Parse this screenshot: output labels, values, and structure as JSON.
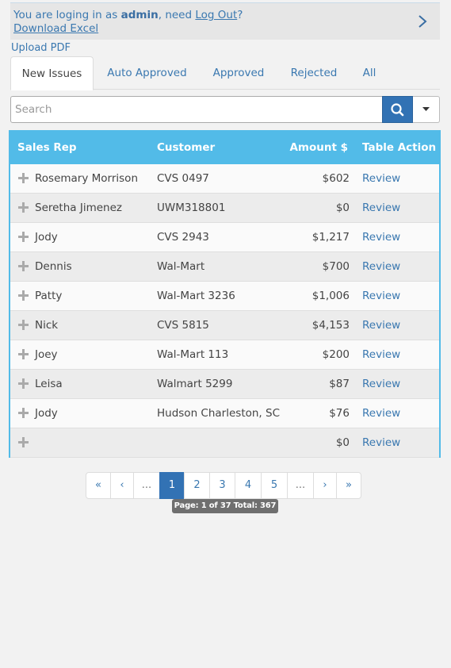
{
  "header": {
    "login_prefix": "You are loging in as ",
    "username": "admin",
    "login_middle": ", need ",
    "logout_label": "Log Out",
    "login_suffix": "?",
    "download_excel_label": "Download Excel",
    "expand_icon": "chevron-right-icon"
  },
  "upload_pdf_label": "Upload PDF",
  "tabs": [
    {
      "label": "New Issues",
      "active": true
    },
    {
      "label": "Auto Approved",
      "active": false
    },
    {
      "label": "Approved",
      "active": false
    },
    {
      "label": "Rejected",
      "active": false
    },
    {
      "label": "All",
      "active": false
    }
  ],
  "search": {
    "placeholder": "Search",
    "value": "",
    "search_icon": "search-icon",
    "dropdown_icon": "caret-down-icon"
  },
  "table": {
    "columns": [
      "Sales Rep",
      "Customer",
      "Amount $",
      "Table Action"
    ],
    "rows": [
      {
        "rep": "Rosemary Morrison",
        "customer": "CVS 0497",
        "amount": "$602",
        "action": "Review"
      },
      {
        "rep": "Seretha Jimenez",
        "customer": "UWM318801",
        "amount": "$0",
        "action": "Review"
      },
      {
        "rep": "Jody",
        "customer": "CVS 2943",
        "amount": "$1,217",
        "action": "Review"
      },
      {
        "rep": "Dennis",
        "customer": "Wal-Mart",
        "amount": "$700",
        "action": "Review"
      },
      {
        "rep": "Patty",
        "customer": "Wal-Mart 3236",
        "amount": "$1,006",
        "action": "Review"
      },
      {
        "rep": "Nick",
        "customer": "CVS 5815",
        "amount": "$4,153",
        "action": "Review"
      },
      {
        "rep": "Joey",
        "customer": "Wal-Mart 113",
        "amount": "$200",
        "action": "Review"
      },
      {
        "rep": "Leisa",
        "customer": "Walmart 5299",
        "amount": "$87",
        "action": "Review"
      },
      {
        "rep": "Jody",
        "customer": "Hudson Charleston, SC",
        "amount": "$76",
        "action": "Review"
      },
      {
        "rep": "",
        "customer": "",
        "amount": "$0",
        "action": "Review"
      }
    ]
  },
  "pagination": {
    "buttons": [
      "«",
      "‹",
      "...",
      "1",
      "2",
      "3",
      "4",
      "5",
      "...",
      "›",
      "»"
    ],
    "active": "1",
    "info": "Page: 1 of 37 Total: 367"
  },
  "colors": {
    "accent": "#52bbe8",
    "link": "#3a78b0",
    "primary_button": "#3272b4"
  }
}
